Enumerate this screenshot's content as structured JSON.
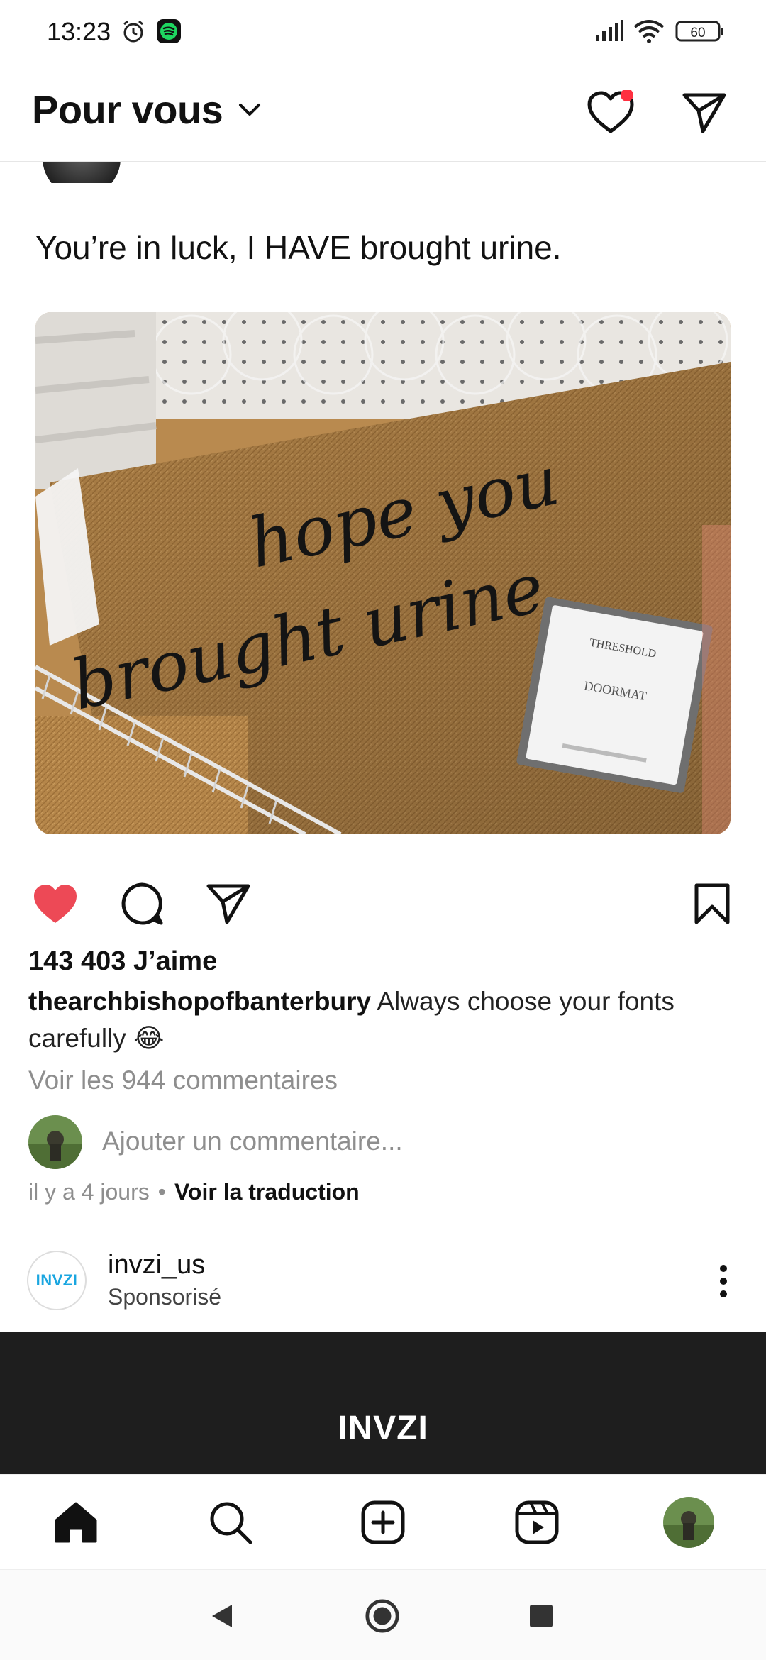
{
  "status_bar": {
    "time": "13:23",
    "battery": "60",
    "icons": [
      "alarm-icon",
      "spotify-icon",
      "signal-icon",
      "wifi-icon",
      "battery-icon"
    ]
  },
  "header": {
    "title": "Pour vous",
    "icons": [
      "chevron-down-icon",
      "heart-icon",
      "send-icon"
    ],
    "notification_dot_color": "#ff3040"
  },
  "post": {
    "text": "You’re in luck, I HAVE brought urine.",
    "image": {
      "mat_line1": "hope you",
      "mat_line2": "brought urine",
      "tag_brand": "THRESHOLD",
      "tag_label": "DOORMAT"
    },
    "likes": "143 403 J’aime",
    "caption_user": "thearchbishopofbanterbury",
    "caption_text": " Always choose your fonts carefully ",
    "caption_emoji": "😂",
    "view_comments": "Voir les 944 commentaires",
    "comment_placeholder": "Ajouter un commentaire...",
    "time_ago": "il y a 4 jours",
    "separator": "•",
    "translate": "Voir la traduction",
    "like_color": "#ed4956"
  },
  "sponsored": {
    "avatar_text": "INVZI",
    "name": "invzi_us",
    "label": "Sponsorisé",
    "banner_text": "INVZI"
  },
  "bottom_nav": [
    "home-icon",
    "search-icon",
    "create-icon",
    "reels-icon",
    "profile-avatar"
  ],
  "system_nav": [
    "back-icon",
    "home-circle-icon",
    "recents-icon"
  ]
}
